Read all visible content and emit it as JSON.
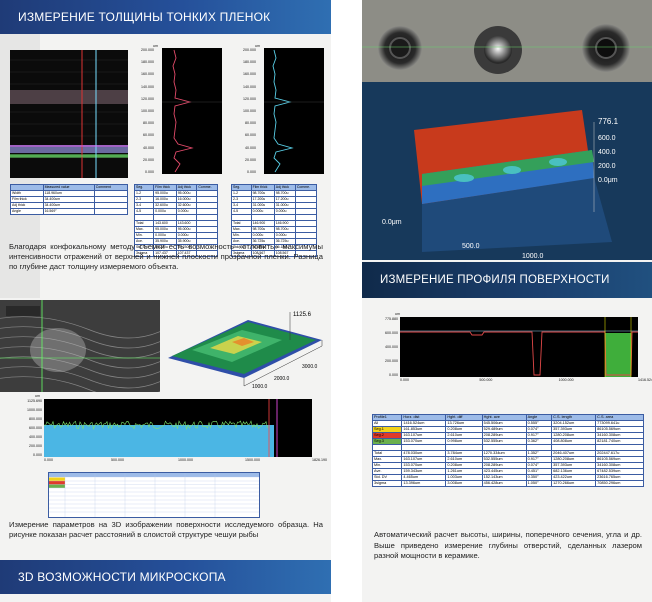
{
  "left_column": {
    "header_title": "ИЗМЕРЕНИЕ ТОЛЩИНЫ ТОНКИХ ПЛЕНОК",
    "thickness_plots": {
      "y_unit": "um",
      "y_ticks": [
        "200.000",
        "180.000",
        "160.000",
        "140.000",
        "120.000",
        "100.000",
        "80.000",
        "60.000",
        "40.000",
        "20.000",
        "0.000"
      ]
    },
    "thickness_table_1": {
      "headers": [
        "",
        "Measured value",
        "Comment"
      ],
      "rows": [
        [
          "Width",
          "118.960um",
          ""
        ],
        [
          "Film thick",
          "34.400um",
          ""
        ],
        [
          "Adj thick",
          "34.400um",
          ""
        ],
        [
          "Angle",
          "16.569°",
          ""
        ]
      ]
    },
    "thickness_table_2": {
      "headers": [
        "Seg.",
        "Film thick",
        "Adj thick",
        "Comme."
      ],
      "rows": [
        [
          "1-2",
          "95.000u",
          "95.000u",
          ""
        ],
        [
          "2-3",
          "16.000u",
          "16.000u",
          ""
        ],
        [
          "3-4",
          "32.600u",
          "32.600u",
          ""
        ],
        [
          "4-5",
          "0.000u",
          "0.000u",
          ""
        ],
        [
          "",
          "",
          " ",
          ""
        ],
        [
          "Total",
          "143.600",
          "143.600",
          ""
        ],
        [
          "Max.",
          "95.000u",
          "95.000u",
          ""
        ],
        [
          "Min.",
          "0.000u",
          "0.000u",
          ""
        ],
        [
          "Ave.",
          "35.900u",
          "35.900u",
          ""
        ],
        [
          "Std. DV",
          "39.230u",
          "39.230u",
          ""
        ],
        [
          "3sigma",
          "107.437",
          "107.437",
          ""
        ]
      ]
    },
    "thickness_table_3": {
      "headers": [
        "Seg.",
        "Film thick",
        "Adj thick",
        "Comme."
      ],
      "rows": [
        [
          "1-2",
          "98.700u",
          "98.700u",
          ""
        ],
        [
          "2-3",
          "17.200u",
          "17.200u",
          ""
        ],
        [
          "3-4",
          "31.000u",
          "31.000u",
          ""
        ],
        [
          "4-5",
          "0.000u",
          "0.000u",
          ""
        ],
        [
          "",
          "",
          "",
          ""
        ],
        [
          "Total",
          "146.900",
          "146.900",
          ""
        ],
        [
          "Max.",
          "98.700u",
          "98.700u",
          ""
        ],
        [
          "Min.",
          "0.000u",
          "0.000u",
          ""
        ],
        [
          "Ave.",
          "36.725u",
          "36.725u",
          ""
        ],
        [
          "Std. DV",
          "36.189u",
          "36.189u",
          ""
        ],
        [
          "3sigma",
          "108.567",
          "108.567",
          ""
        ]
      ]
    },
    "paragraph_1": "Благодаря конфокальному методу съемки есть возможность «отловить» максимумы интенсивности отражений от верхней и нижней плоскости прозрачной пленки. Разница по глубине даст толщину измеряемого объекта.",
    "surface3d_labels": {
      "z_top": "1125.6",
      "x_a": "1000.0",
      "x_b": "2000.0",
      "x_c": "3000.0"
    },
    "profile_chart": {
      "y_ticks": [
        "1125.690",
        "1000.000",
        "800.000",
        "600.000",
        "400.000",
        "200.000",
        "0.000"
      ],
      "x_ticks": [
        "0.000",
        "500.000",
        "1000.000",
        "1500.000",
        "1826.190"
      ],
      "unit": "um"
    },
    "paragraph_2": "Измерение параметров на 3D изображении поверхности исследуемого образца. На рисунке показан расчет расстояний в слоистой структуре чешуи рыбы",
    "footer_title": "3D ВОЗМОЖНОСТИ МИКРОСКОПА"
  },
  "right_column": {
    "surface_labels": {
      "z_top": "776.1",
      "z_b": "600.0",
      "z_c": "400.0",
      "z_d": "200.0",
      "z_zero": "0.0μm",
      "x_left": "0.0μm",
      "x_mid": "500.0",
      "x_right": "1000.0"
    },
    "section_title": "ИЗМЕРЕНИЕ ПРОФИЛЯ ПОВЕРХНОСТИ",
    "profile_chart": {
      "unit": "um",
      "y_ticks": [
        "775.880",
        "600.000",
        "400.000",
        "200.000",
        "0.000"
      ],
      "x_ticks": [
        "0.000",
        "500.000",
        "1000.000",
        "1416.524"
      ]
    },
    "profile_table": {
      "headers": [
        "Profile1",
        "Horz. dist",
        "Hght. diff",
        "Hght. ave",
        "Angle",
        "C.S. length",
        "C.S. area"
      ],
      "rows": [
        [
          "All",
          "1416.524um",
          "13.726um",
          "545.506um",
          "0.555°",
          "3204.152um",
          "773099.641u"
        ],
        [
          "Seg.1",
          "161.853um",
          "0.208um",
          "529.489um",
          "0.074°",
          "357.393um",
          "86105.569um"
        ],
        [
          "Seg.2",
          "163.107um",
          "2.610um",
          "208.289um",
          "0.917°",
          "1280.208um",
          "34160.308um"
        ],
        [
          "Seg.3",
          "153.070um",
          "0.998um",
          "532.555um",
          "0.362°",
          "408.808um",
          "82181.740um"
        ],
        [
          "",
          "",
          "",
          "",
          "",
          "",
          ""
        ],
        [
          "Total",
          "478.030um",
          "3.784um",
          "1270.334um",
          "1.352°",
          "2046.407um",
          "202447.617u"
        ],
        [
          "Max.",
          "163.107um",
          "2.610um",
          "532.555um",
          "0.917°",
          "1280.208um",
          "86105.569um"
        ],
        [
          "Min.",
          "153.070um",
          "0.208um",
          "208.289um",
          "0.074°",
          "357.393um",
          "34160.308um"
        ],
        [
          "Ave.",
          "159.343um",
          "1.261um",
          "423.445um",
          "0.451°",
          "682.136um",
          "67482.539um"
        ],
        [
          "Std. DV",
          "4.465um",
          "1.003um",
          "152.143um",
          "0.350°",
          "423.422um",
          "23616.765um"
        ],
        [
          "3sigma",
          "13.396um",
          "3.008um",
          "456.428um",
          "1.050°",
          "1270.266um",
          "70850.296um"
        ]
      ],
      "row_colors": [
        "#ffffff",
        "#f2d21b",
        "#e03a2b",
        "#6ab04c"
      ]
    },
    "paragraph": "Автоматический расчет высоты, ширины, поперечного сечения, угла и др. Выше приведено измерение глубины отверстий, сделанных лазером разной мощности в керамике."
  },
  "colors": {
    "band": "#25509a",
    "teal_bg": "#16395a",
    "table_header": "#9dbbe8"
  }
}
